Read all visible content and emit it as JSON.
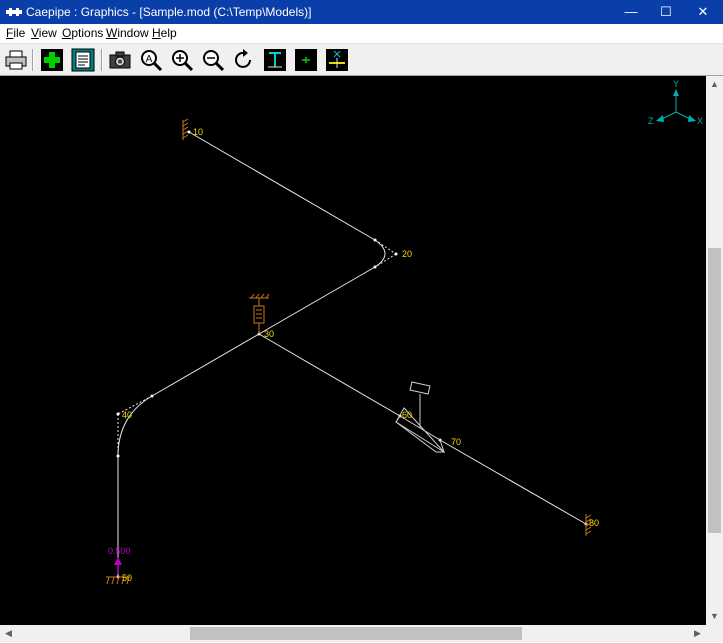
{
  "window": {
    "title": "Caepipe : Graphics -  [Sample.mod (C:\\Temp\\Models)]",
    "minimize": "—",
    "maximize": "☐",
    "close": "✕"
  },
  "menu": {
    "items": [
      {
        "accel": "F",
        "rest": "ile"
      },
      {
        "accel": "V",
        "rest": "iew"
      },
      {
        "accel": "O",
        "rest": "ptions"
      },
      {
        "accel": "W",
        "rest": "indow"
      },
      {
        "accel": "H",
        "rest": "elp"
      }
    ]
  },
  "toolbar": {
    "icons": [
      "printer-icon",
      "add-icon",
      "report-icon",
      "camera-icon",
      "zoom-all-icon",
      "zoom-in-icon",
      "zoom-out-icon",
      "rotate-icon",
      "view-xy-icon",
      "view-z-icon",
      "view-x-icon"
    ]
  },
  "axes": {
    "y": "Y",
    "x": "X",
    "z": "Z"
  },
  "nodes": {
    "n10": "10",
    "n20": "20",
    "n30": "30",
    "n40": "40",
    "n50": "50",
    "n60": "60",
    "n70": "70",
    "n80": "80"
  },
  "load_label": "0.500",
  "colors": {
    "pipe": "#e8e8e8",
    "node_label": "#ffd700",
    "anchor": "#c87814",
    "load": "#c000c0",
    "axis": "#00b0b0"
  }
}
